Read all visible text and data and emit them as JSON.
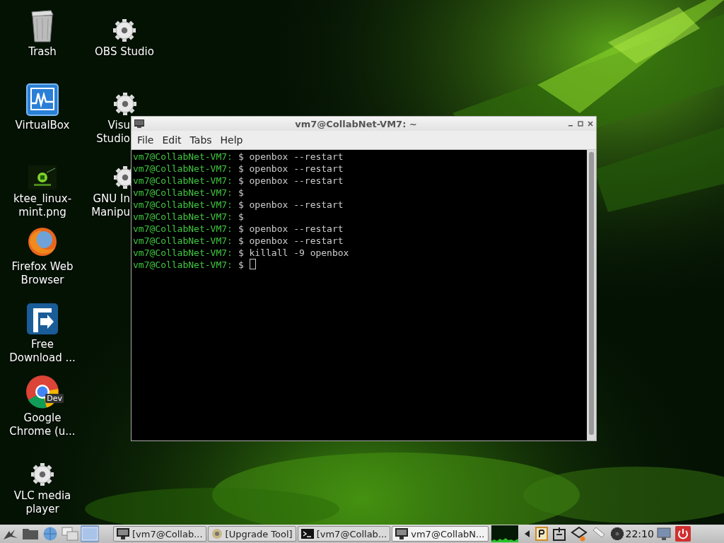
{
  "desktop_icons": [
    {
      "kind": "trash",
      "lines": [
        "Trash"
      ]
    },
    {
      "kind": "virtualbox",
      "lines": [
        "VirtualBox"
      ]
    },
    {
      "lines": [
        "ktee_linux-",
        "mint.png"
      ]
    },
    {
      "kind": "firefox",
      "lines": [
        "Firefox Web",
        "Browser"
      ]
    },
    {
      "kind": "download",
      "lines": [
        "Free",
        "Download ..."
      ]
    },
    {
      "kind": "chrome",
      "lines": [
        "Google",
        "Chrome (u..."
      ],
      "badge": "Dev"
    },
    {
      "kind": "gear",
      "lines": [
        "VLC media",
        "player"
      ]
    },
    {
      "kind": "gear",
      "lines": [
        "OBS Studio"
      ]
    },
    {
      "kind": "gear",
      "lines": [
        "Visu",
        "Studio"
      ]
    },
    {
      "kind": "gear",
      "lines": [
        "GNU In",
        "Manipu"
      ]
    }
  ],
  "terminal": {
    "title": "vm7@CollabNet-VM7: ~",
    "menu": [
      "File",
      "Edit",
      "Tabs",
      "Help"
    ],
    "cursor": true,
    "lines": [
      {
        "prompt": "vm7@CollabNet-VM7:",
        "command": "$ openbox --restart"
      },
      {
        "prompt": "vm7@CollabNet-VM7:",
        "command": "$ openbox --restart"
      },
      {
        "prompt": "vm7@CollabNet-VM7:",
        "command": "$ openbox --restart"
      },
      {
        "prompt": "vm7@CollabNet-VM7:",
        "command": "$"
      },
      {
        "prompt": "vm7@CollabNet-VM7:",
        "command": "$ openbox --restart"
      },
      {
        "prompt": "vm7@CollabNet-VM7:",
        "command": "$"
      },
      {
        "prompt": "vm7@CollabNet-VM7:",
        "command": "$ openbox --restart"
      },
      {
        "prompt": "vm7@CollabNet-VM7:",
        "command": "$ openbox --restart"
      },
      {
        "prompt": "vm7@CollabNet-VM7:",
        "command": "$ killall -9 openbox"
      },
      {
        "prompt": "vm7@CollabNet-VM7:",
        "command": "$"
      }
    ]
  },
  "taskbar": {
    "launchers": [
      {
        "kind": "menu",
        "selected": false
      },
      {
        "kind": "folder",
        "selected": false
      },
      {
        "kind": "globe",
        "selected": false
      },
      {
        "kind": "windows",
        "selected": false
      },
      {
        "kind": "desktop",
        "selected": true
      }
    ],
    "tasks": [
      {
        "kind": "monitor",
        "label": "[vm7@Collab...",
        "selected": false
      },
      {
        "kind": "upgrade",
        "label": "[Upgrade Tool]",
        "selected": false
      },
      {
        "kind": "terminal",
        "label": "[vm7@Collab...",
        "selected": false
      },
      {
        "kind": "monitor",
        "label": "vm7@CollabN...",
        "selected": true
      }
    ],
    "clock": "22:10"
  }
}
